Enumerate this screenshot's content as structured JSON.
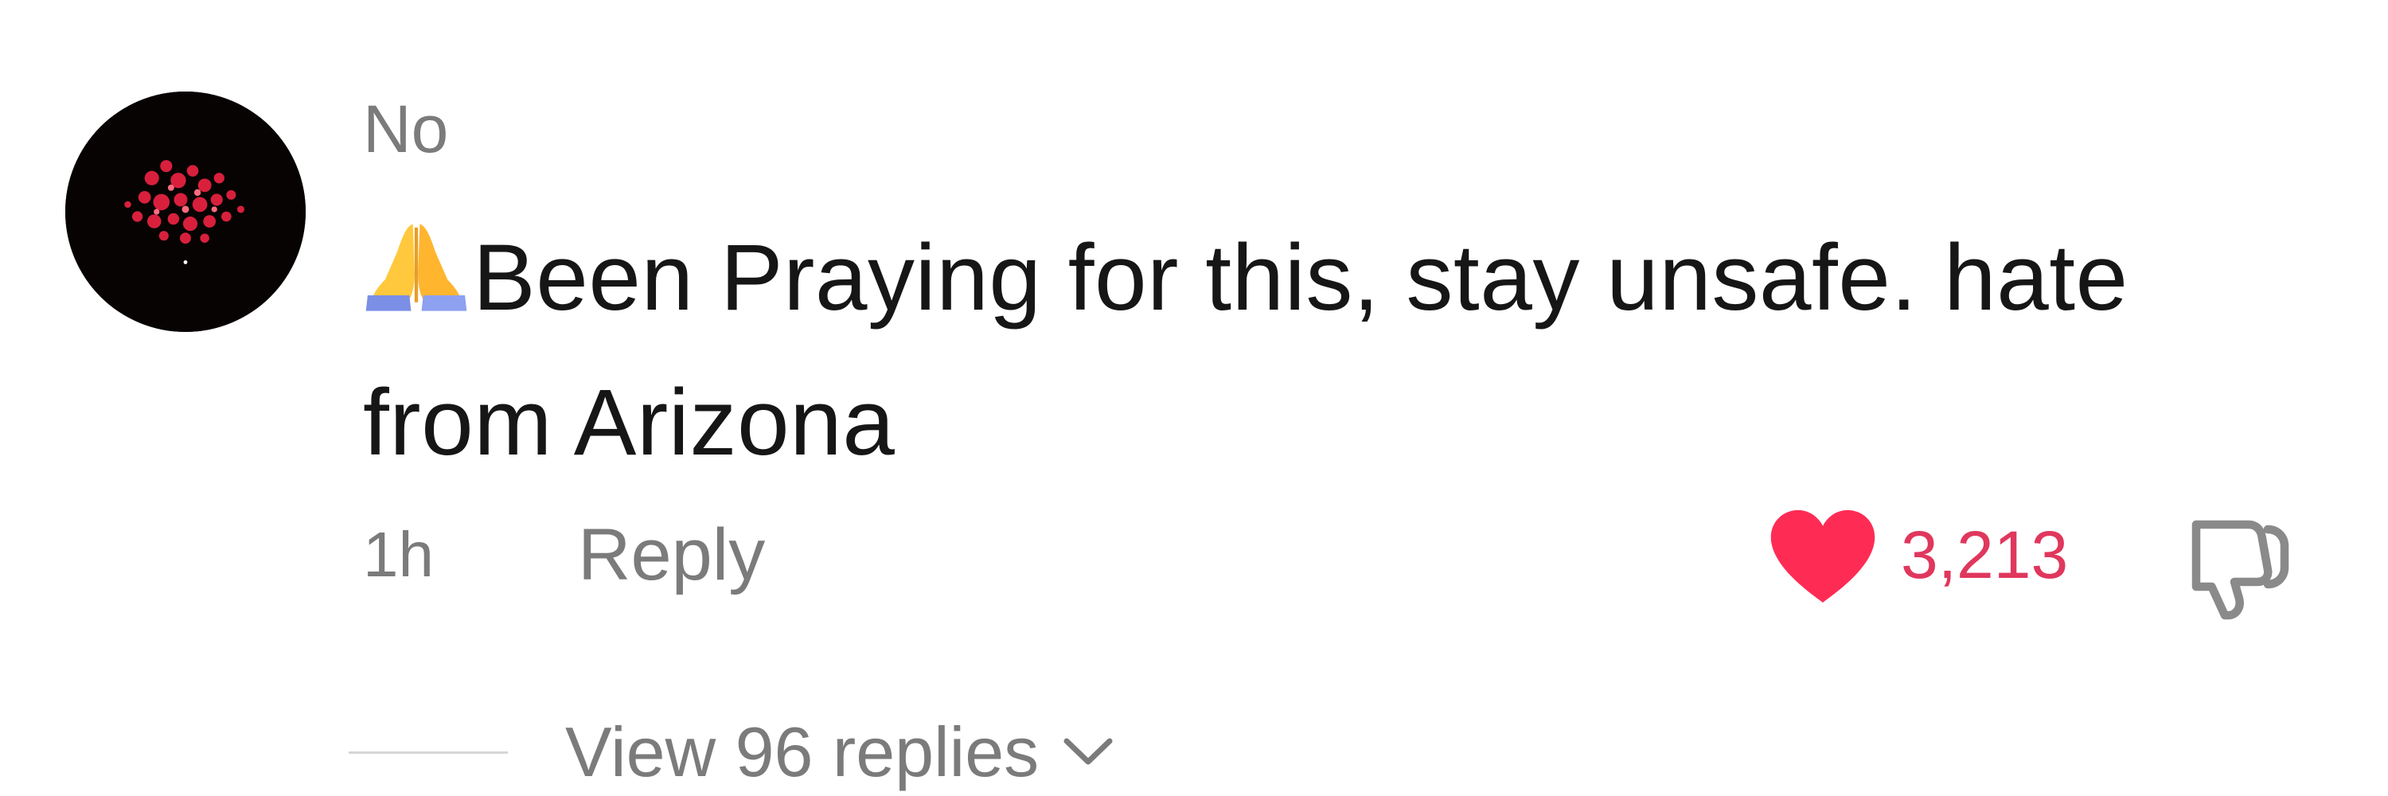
{
  "comment": {
    "avatar_icon": "avatar-fireworks-icon",
    "username": "No",
    "text_lines": [
      "Been Praying for this, stay unsafe. hate",
      "from Arizona"
    ],
    "emoji_icon": "praying-hands-icon",
    "timestamp": "1h",
    "reply_label": "Reply",
    "like_count": "3,213",
    "like_icon": "heart-icon",
    "dislike_icon": "thumbs-down-icon",
    "view_replies_label": "View 96 replies",
    "view_replies_icon": "chevron-down-icon"
  },
  "colors": {
    "username": "#7b7b7b",
    "text": "#161616",
    "meta": "#7b7b7b",
    "like": "#fe2c55",
    "like_count": "#e0375d",
    "divider": "#d6d6d6"
  }
}
